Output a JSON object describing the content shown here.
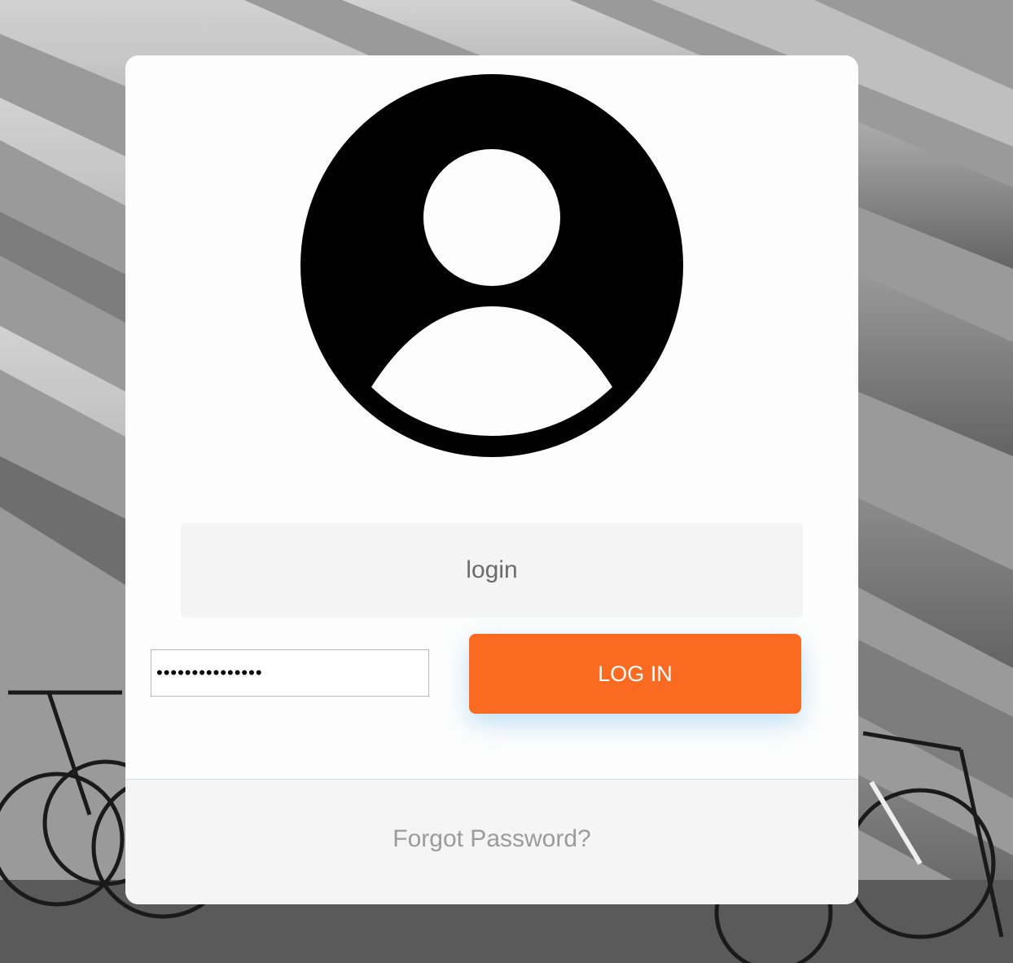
{
  "background": {
    "description_icon": "concrete-ceiling-with-bikes-photo"
  },
  "card": {
    "avatar_icon": "user-avatar-icon",
    "login_field": {
      "value": "",
      "placeholder": "login"
    },
    "password_field": {
      "value": "•••••••••••••••"
    },
    "login_button_label": "LOG IN",
    "forgot_password_label": "Forgot Password?"
  },
  "colors": {
    "accent": "#fb6a21",
    "card_bg": "#fdfdfd",
    "footer_bg": "#f5f5f5"
  }
}
